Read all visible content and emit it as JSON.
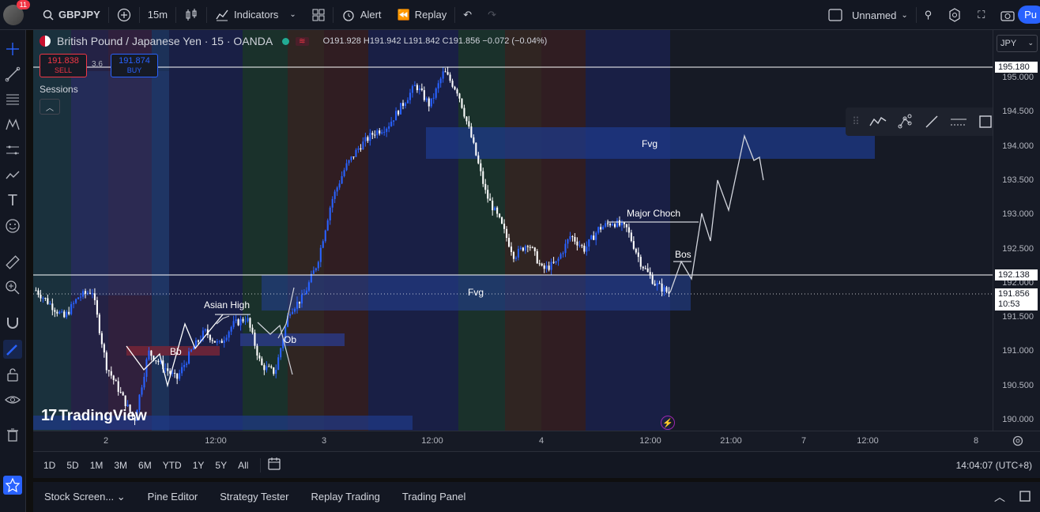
{
  "topbar": {
    "notif_count": "11",
    "symbol": "GBPJPY",
    "interval": "15m",
    "indicators": "Indicators",
    "alert": "Alert",
    "replay": "Replay",
    "layout_name": "Unnamed",
    "publish": "Pu"
  },
  "legend": {
    "title": "British Pound / Japanese Yen · 15 · OANDA",
    "ohlc": "O191.928  H191.942  L191.842  C191.856  −0.072 (−0.04%)",
    "sell_price": "191.838",
    "sell_label": "SELL",
    "spread": "3.6",
    "buy_price": "191.874",
    "buy_label": "BUY",
    "sessions": "Sessions"
  },
  "currency": "JPY",
  "price_axis": {
    "ticks": [
      "195.000",
      "194.500",
      "194.000",
      "193.500",
      "193.000",
      "192.500",
      "192.000",
      "191.500",
      "191.000",
      "190.500",
      "190.000"
    ],
    "line_high": "195.180",
    "line_mid": "192.138",
    "current_price": "191.856",
    "countdown": "10:53"
  },
  "time_axis": {
    "ticks": [
      "2",
      "12:00",
      "3",
      "12:00",
      "4",
      "12:00",
      "21:00",
      "7",
      "12:00",
      "8"
    ]
  },
  "annotations": {
    "fvg_top": "Fvg",
    "fvg_mid": "Fvg",
    "major_choch": "Major Choch",
    "bos": "Bos",
    "asian_high": "Asian High",
    "ob": "Ob",
    "bb": "Bb"
  },
  "logo": "TradingView",
  "range_bar": {
    "ranges": [
      "1D",
      "5D",
      "1M",
      "3M",
      "6M",
      "YTD",
      "1Y",
      "5Y",
      "All"
    ],
    "clock": "14:04:07 (UTC+8)"
  },
  "bottom_tabs": [
    "Stock Screen...",
    "Pine Editor",
    "Strategy Tester",
    "Replay Trading",
    "Trading Panel"
  ],
  "colors": {
    "bull": "#2962ff",
    "bear": "#ffffff",
    "background": "#161a25",
    "accent": "#2962ff"
  },
  "chart_data": {
    "type": "candlestick",
    "symbol": "GBPJPY",
    "ylim": [
      189.9,
      195.4
    ],
    "close_path": [
      191.9,
      191.7,
      191.5,
      191.8,
      191.9,
      190.8,
      190.4,
      190.0,
      191.0,
      190.8,
      190.6,
      191.0,
      191.3,
      191.1,
      191.4,
      191.5,
      190.8,
      190.7,
      191.6,
      191.8,
      192.3,
      193.2,
      193.7,
      194.0,
      194.2,
      194.3,
      194.6,
      194.9,
      194.6,
      195.1,
      194.8,
      194.1,
      193.3,
      192.9,
      192.4,
      192.6,
      192.2,
      192.3,
      192.7,
      192.5,
      192.8,
      192.9,
      192.8,
      192.3,
      192.0,
      191.86
    ]
  }
}
